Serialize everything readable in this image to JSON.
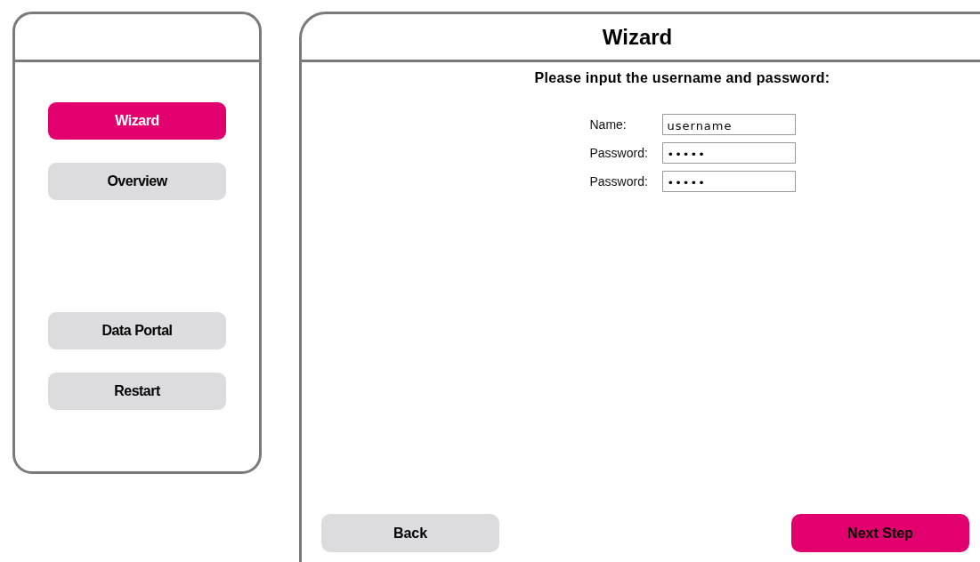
{
  "sidebar": {
    "items": [
      {
        "label": "Wizard",
        "selected": true
      },
      {
        "label": "Overview",
        "selected": false
      },
      {
        "label": "Data Portal",
        "selected": false
      },
      {
        "label": "Restart",
        "selected": false
      }
    ]
  },
  "main": {
    "title": "Wizard",
    "prompt": "Please input the username and password:",
    "fields": [
      {
        "label": "Name:",
        "value": "username"
      },
      {
        "label": "Password:",
        "value": "•••••"
      },
      {
        "label": "Password:",
        "value": "•••••"
      }
    ],
    "buttons": [
      {
        "label": "Back",
        "kind": "secondary"
      },
      {
        "label": "Next Step",
        "kind": "primary"
      }
    ]
  }
}
